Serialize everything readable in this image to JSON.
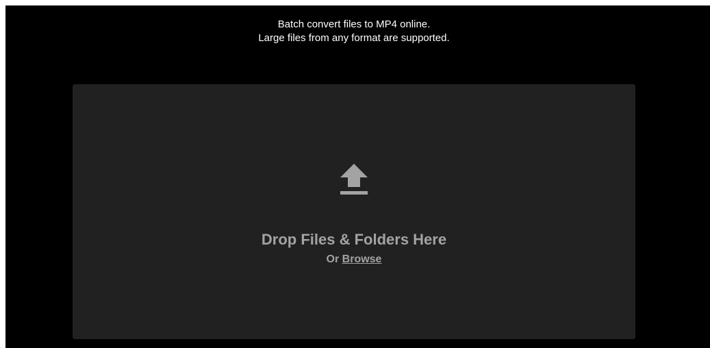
{
  "intro": {
    "line1": "Batch convert files to MP4 online.",
    "line2": "Large files from any format are supported."
  },
  "dropzone": {
    "icon": "upload-icon",
    "title": "Drop Files & Folders Here",
    "or_text": "Or",
    "browse_label": "Browse"
  },
  "colors": {
    "background": "#000000",
    "dropzone_bg": "#212121",
    "dropzone_text": "#a3a3a3",
    "intro_text": "#ffffff"
  }
}
